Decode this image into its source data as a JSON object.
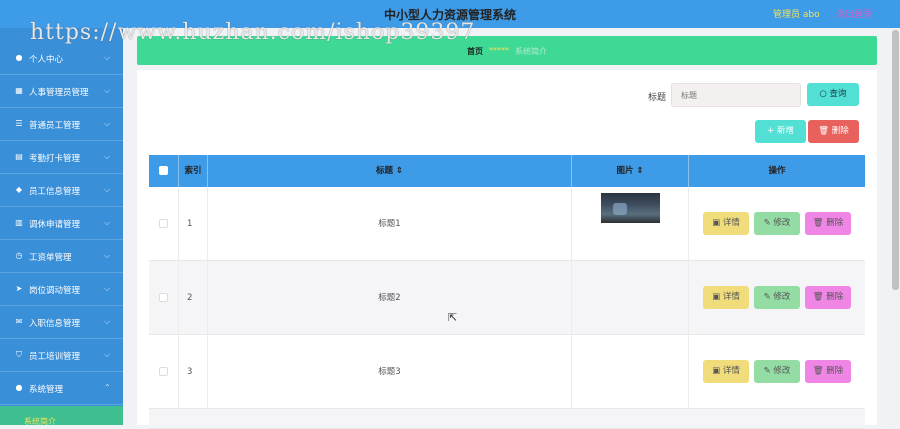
{
  "header": {
    "title": "中小型人力资源管理系统",
    "user": "管理员 abo",
    "logout": "退出登录"
  },
  "watermark": "https://www.huzhan.com/ishop39397",
  "sidebar": {
    "items": [
      {
        "label": "个人中心",
        "icon": "user-icon"
      },
      {
        "label": "人事管理员管理",
        "icon": "grid-icon"
      },
      {
        "label": "普通员工管理",
        "icon": "list-icon"
      },
      {
        "label": "考勤打卡管理",
        "icon": "calendar-icon"
      },
      {
        "label": "员工信息管理",
        "icon": "pin-icon"
      },
      {
        "label": "调休申请管理",
        "icon": "building-icon"
      },
      {
        "label": "工资单管理",
        "icon": "clock-icon"
      },
      {
        "label": "岗位调动管理",
        "icon": "send-icon"
      },
      {
        "label": "入职信息管理",
        "icon": "mail-icon"
      },
      {
        "label": "员工培训管理",
        "icon": "shield-icon"
      },
      {
        "label": "系统管理",
        "icon": "user-icon"
      }
    ],
    "submenu_label": "系统简介",
    "arrow": "⌵"
  },
  "breadcrumb": {
    "home": "首页",
    "separator": "*****",
    "current": "系统简介"
  },
  "search": {
    "label": "标题",
    "placeholder": "标题",
    "query_label": "查询",
    "add_label": "新增",
    "delete_label": "删除"
  },
  "table": {
    "headers": {
      "index": "索引",
      "title": "标题 ⇕",
      "image": "图片 ⇕",
      "ops": "操作"
    },
    "rows": [
      {
        "index": "1",
        "title": "标题1",
        "has_image": true
      },
      {
        "index": "2",
        "title": "标题2",
        "has_image": false
      },
      {
        "index": "3",
        "title": "标题3",
        "has_image": false
      }
    ],
    "actions": {
      "detail": "详情",
      "edit": "修改",
      "delete": "删除"
    }
  },
  "colors": {
    "header": "#3d9be8",
    "sidebar": "#3a8fd9",
    "breadcrumb": "#3fd996",
    "detail": "#f0dc7a",
    "edit": "#93dca4",
    "delete": "#ef86e6"
  }
}
